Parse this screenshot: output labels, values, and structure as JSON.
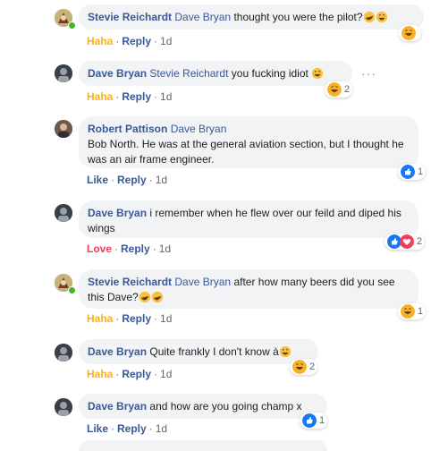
{
  "comments": [
    {
      "author": "Stevie Reichardt",
      "mention": "Dave Bryan",
      "text": "thought you were the pilot?",
      "action_reaction": "Haha",
      "reply": "Reply",
      "time": "1d",
      "reaction_icons": [
        "haha-icon"
      ],
      "reaction_count": ""
    },
    {
      "author": "Dave Bryan",
      "mention": "Stevie Reichardt",
      "text": "you fucking idiot",
      "action_reaction": "Haha",
      "reply": "Reply",
      "time": "1d",
      "reaction_icons": [
        "haha-icon"
      ],
      "reaction_count": "2"
    },
    {
      "author": "Robert Pattison",
      "mention": "Dave Bryan",
      "text": "Bob North. He was at the general aviation section, but I thought he was an air frame engineer.",
      "action_reaction": "Like",
      "reply": "Reply",
      "time": "1d",
      "reaction_icons": [
        "like-icon"
      ],
      "reaction_count": "1"
    },
    {
      "author": "Dave Bryan",
      "mention": "",
      "text": "i remember when he flew over our feild and diped his wings",
      "action_reaction": "Love",
      "reply": "Reply",
      "time": "1d",
      "reaction_icons": [
        "like-icon",
        "love-icon"
      ],
      "reaction_count": "2"
    },
    {
      "author": "Stevie Reichardt",
      "mention": "Dave Bryan",
      "text": "after how many beers did you see this Dave?",
      "action_reaction": "Haha",
      "reply": "Reply",
      "time": "1d",
      "reaction_icons": [
        "haha-icon"
      ],
      "reaction_count": "1"
    },
    {
      "author": "Dave Bryan",
      "mention": "",
      "text": "Quite frankly I don't know à",
      "action_reaction": "Haha",
      "reply": "Reply",
      "time": "1d",
      "reaction_icons": [
        "haha-icon"
      ],
      "reaction_count": "2"
    },
    {
      "author": "Dave Bryan",
      "mention": "",
      "text": "and how are you going champ x",
      "action_reaction": "Like",
      "reply": "Reply",
      "time": "1d",
      "reaction_icons": [
        "like-icon"
      ],
      "reaction_count": "1"
    }
  ],
  "colors": {
    "link": "#385898",
    "haha": "#f7b125",
    "love": "#f33e58",
    "like": "#1877f2",
    "bubble": "#f2f3f5",
    "online": "#42b72a"
  },
  "separator": "·"
}
